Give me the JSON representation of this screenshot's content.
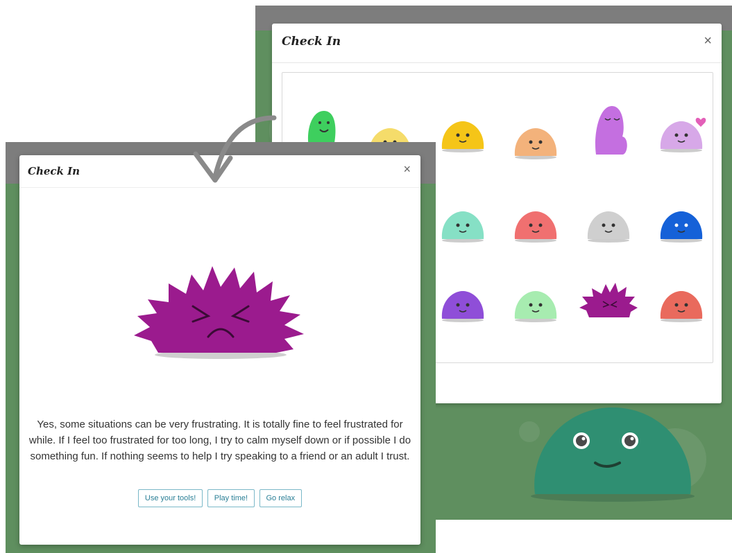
{
  "back_modal": {
    "title": "Check In",
    "close": "×",
    "emotions": [
      {
        "name": "green-excited",
        "color": "#3ecf5e"
      },
      {
        "name": "pale-yellow-happy",
        "color": "#f5dc6a"
      },
      {
        "name": "yellow-laughing",
        "color": "#f5c518"
      },
      {
        "name": "peach-calm",
        "color": "#f3b27b"
      },
      {
        "name": "purple-shy",
        "color": "#c46fe0"
      },
      {
        "name": "lilac-love",
        "color": "#d7a8e8"
      },
      {
        "name": "mint-content",
        "color": "#86e0c5"
      },
      {
        "name": "pink-small",
        "color": "#f07070"
      },
      {
        "name": "grey-meh",
        "color": "#cfcfcf"
      },
      {
        "name": "blue-surprised",
        "color": "#1561d8"
      },
      {
        "name": "violet-worried",
        "color": "#8f4ed8"
      },
      {
        "name": "light-green-nervous",
        "color": "#a7ecb0"
      },
      {
        "name": "magenta-frustrated",
        "color": "#9b1b8e"
      },
      {
        "name": "coral-sad",
        "color": "#e96a5d"
      }
    ]
  },
  "front_modal": {
    "title": "Check In",
    "close": "×",
    "message": "Yes, some situations can be very frustrating. It is totally fine to feel frustrated for while. If I feel too frustrated for too long, I try to calm myself down or if possible I do something fun. If nothing seems to help I try speaking to a friend or an adult I trust.",
    "buttons": [
      "Use your tools!",
      "Play time!",
      "Go relax"
    ]
  },
  "colors": {
    "background_green": "#5f8f5f",
    "frustrated_purple": "#9b1b8e",
    "big_blob": "#2f8f72",
    "button_text": "#2a7f96"
  }
}
